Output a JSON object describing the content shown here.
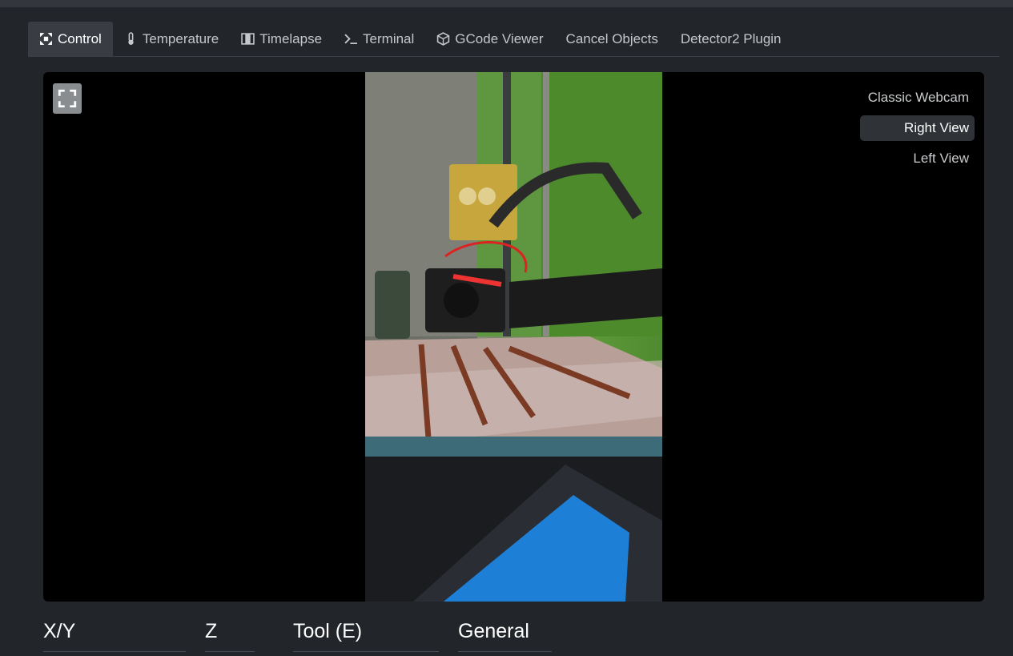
{
  "tabs": [
    {
      "label": "Control",
      "icon": "control-arrows-icon",
      "active": true
    },
    {
      "label": "Temperature",
      "icon": "thermometer-icon",
      "active": false
    },
    {
      "label": "Timelapse",
      "icon": "film-icon",
      "active": false
    },
    {
      "label": "Terminal",
      "icon": "terminal-icon",
      "active": false
    },
    {
      "label": "GCode Viewer",
      "icon": "cube-icon",
      "active": false
    },
    {
      "label": "Cancel Objects",
      "icon": "",
      "active": false
    },
    {
      "label": "Detector2 Plugin",
      "icon": "",
      "active": false
    }
  ],
  "webcam": {
    "fullscreen_icon": "fullscreen-icon",
    "views": [
      {
        "label": "Classic Webcam",
        "active": false
      },
      {
        "label": "Right View",
        "active": true
      },
      {
        "label": "Left View",
        "active": false
      }
    ]
  },
  "sections": {
    "xy": "X/Y",
    "z": "Z",
    "tool": "Tool (E)",
    "general": "General"
  },
  "colors": {
    "background": "#222529",
    "active_tab": "#393d43",
    "webcam_bg": "#000000"
  }
}
